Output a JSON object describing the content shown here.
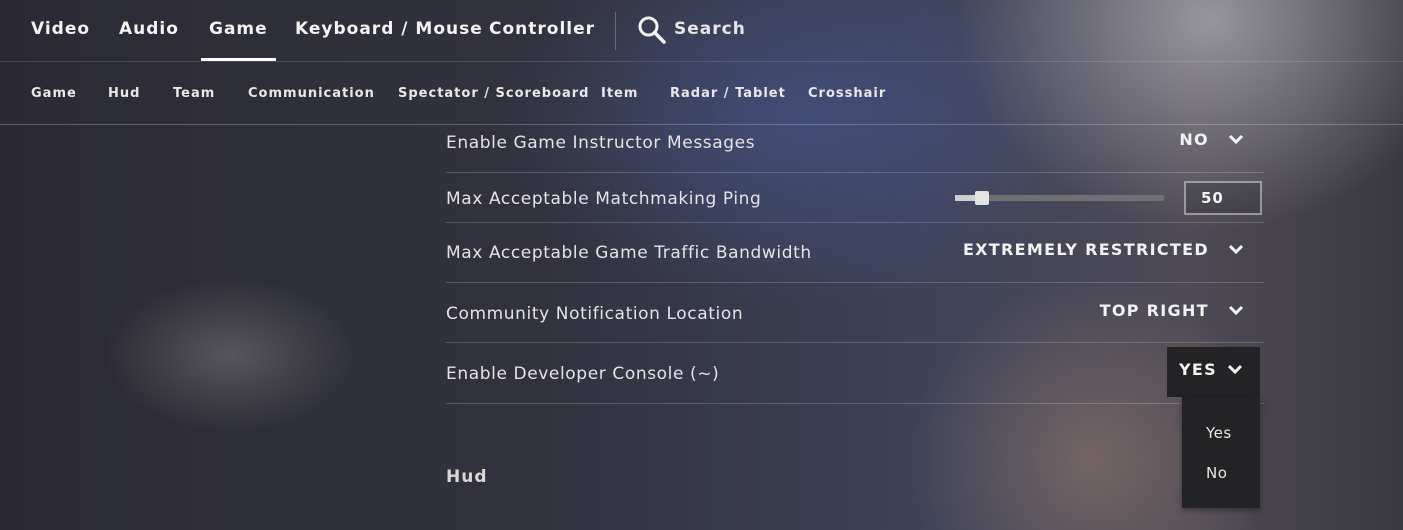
{
  "top_tabs": [
    {
      "label": "Video"
    },
    {
      "label": "Audio"
    },
    {
      "label": "Game"
    },
    {
      "label": "Keyboard / Mouse"
    },
    {
      "label": "Controller"
    }
  ],
  "active_top_tab": "Game",
  "search": {
    "label": "Search",
    "icon": "search-icon"
  },
  "sub_tabs": [
    {
      "label": "Game"
    },
    {
      "label": "Hud"
    },
    {
      "label": "Team"
    },
    {
      "label": "Communication"
    },
    {
      "label": "Spectator / Scoreboard"
    },
    {
      "label": "Item"
    },
    {
      "label": "Radar / Tablet"
    },
    {
      "label": "Crosshair"
    }
  ],
  "settings": {
    "game_instructor": {
      "label": "Enable Game Instructor Messages",
      "value": "NO"
    },
    "matchmaking_ping": {
      "label": "Max Acceptable Matchmaking Ping",
      "value": "50",
      "slider_fraction": 0.1
    },
    "traffic_bandwidth": {
      "label": "Max Acceptable Game Traffic Bandwidth",
      "value": "EXTREMELY RESTRICTED"
    },
    "notification_location": {
      "label": "Community Notification Location",
      "value": "TOP RIGHT"
    },
    "developer_console": {
      "label": "Enable Developer Console (~)",
      "value": "YES",
      "options": [
        "Yes",
        "No"
      ]
    }
  },
  "section_hud": {
    "title": "Hud"
  },
  "colors": {
    "highlight": "#ffffff",
    "dropdown_bg": "#232325"
  }
}
